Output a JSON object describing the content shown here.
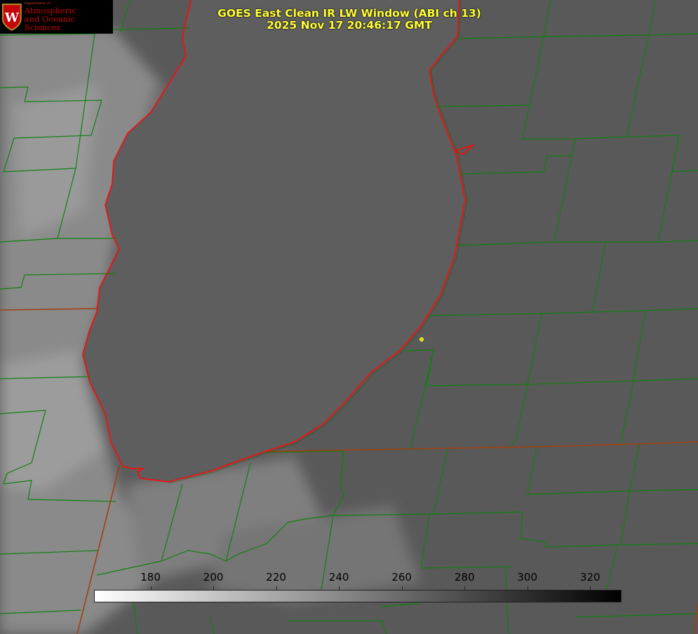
{
  "header": {
    "title_line1": "GOES East Clean IR LW Window (ABI ch 13)",
    "title_line2": "2025 Nov 17 20:46:17 GMT"
  },
  "logo": {
    "dept_line": "Department of",
    "line1": "Atmospheric",
    "line2": "and Oceanic Sciences",
    "crest_letter": "W",
    "crest_icon": "uw-crest-icon"
  },
  "colorbar": {
    "ticks": [
      "180",
      "200",
      "220",
      "240",
      "260",
      "280",
      "300",
      "320"
    ],
    "tick_values": [
      180,
      200,
      220,
      240,
      260,
      280,
      300,
      320
    ],
    "range": [
      162,
      330
    ],
    "gradient": {
      "low": "#ffffff",
      "high": "#000000"
    }
  },
  "map": {
    "colors": {
      "lake": "#5e5e5e",
      "land": "#5a5a5a",
      "cloud": "#8f8f8f",
      "county_border": "#108010",
      "state_border": "#a04010",
      "shoreline": "#ee1111",
      "marker": "#dddd22"
    }
  }
}
